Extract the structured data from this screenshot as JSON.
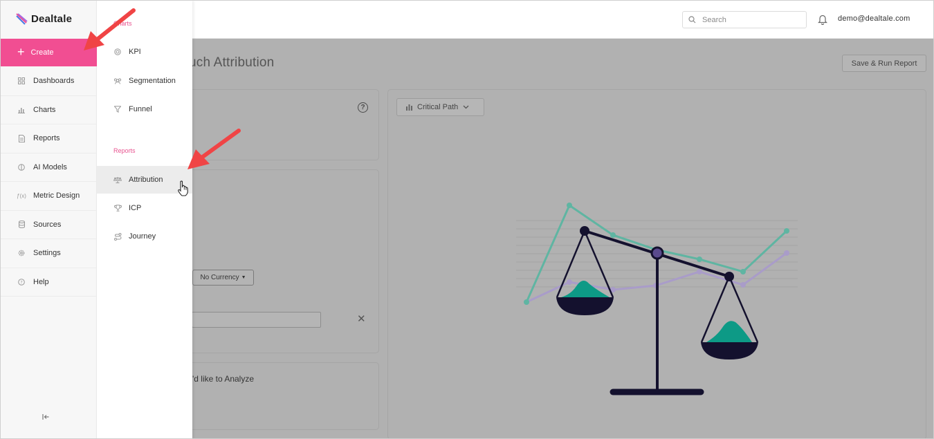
{
  "brand": {
    "name": "Dealtale"
  },
  "header": {
    "search_placeholder": "Search",
    "user_email": "demo@dealtale.com"
  },
  "sidebar": {
    "create_label": "Create",
    "items": [
      {
        "label": "Dashboards",
        "icon": "dashboard-icon"
      },
      {
        "label": "Charts",
        "icon": "bar-chart-icon"
      },
      {
        "label": "Reports",
        "icon": "document-icon"
      },
      {
        "label": "AI Models",
        "icon": "brain-icon"
      },
      {
        "label": "Metric Design",
        "icon": "function-icon"
      },
      {
        "label": "Sources",
        "icon": "database-icon"
      },
      {
        "label": "Settings",
        "icon": "gear-icon"
      },
      {
        "label": "Help",
        "icon": "help-icon"
      }
    ]
  },
  "flyout": {
    "charts_heading": "Charts",
    "charts_items": [
      {
        "label": "KPI",
        "icon": "target-icon"
      },
      {
        "label": "Segmentation",
        "icon": "people-icon"
      },
      {
        "label": "Funnel",
        "icon": "funnel-icon"
      }
    ],
    "reports_heading": "Reports",
    "reports_items": [
      {
        "label": "Attribution",
        "icon": "scale-icon"
      },
      {
        "label": "ICP",
        "icon": "trophy-icon"
      },
      {
        "label": "Journey",
        "icon": "route-icon"
      }
    ]
  },
  "main": {
    "page_title": "uch Attribution",
    "save_run_label": "Save & Run Report",
    "currency_label": "No Currency",
    "analyze_text": "'d like to Analyze",
    "critical_path_label": "Critical Path"
  },
  "colors": {
    "accent_pink": "#f14e92",
    "teal": "#5fb5a2",
    "purple": "#a99cc9",
    "navy": "#14112e",
    "overlay_gray": "#b1b1b1"
  }
}
